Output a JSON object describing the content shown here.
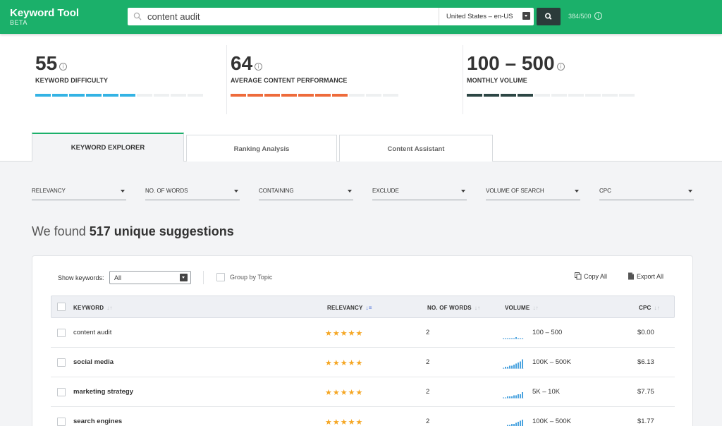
{
  "app": {
    "title": "Keyword Tool",
    "subtitle": "BETA"
  },
  "search": {
    "value": "content audit",
    "locale": "United States – en-US",
    "quota": "384/500"
  },
  "metrics": [
    {
      "value": "55",
      "label": "KEYWORD DIFFICULTY",
      "color": "#34b3e4",
      "filled": 6,
      "total": 10
    },
    {
      "value": "64",
      "label": "AVERAGE CONTENT PERFORMANCE",
      "color": "#ee6b3b",
      "filled": 7,
      "total": 10
    },
    {
      "value": "100 – 500",
      "label": "MONTHLY VOLUME",
      "color": "#2c4644",
      "filled": 4,
      "total": 10
    }
  ],
  "tabs": [
    {
      "label": "KEYWORD EXPLORER",
      "active": true
    },
    {
      "label": "Ranking Analysis",
      "active": false
    },
    {
      "label": "Content Assistant",
      "active": false
    }
  ],
  "filters": [
    "RELEVANCY",
    "NO. OF WORDS",
    "CONTAINING",
    "EXCLUDE",
    "VOLUME OF SEARCH",
    "CPC"
  ],
  "results": {
    "prefix": "We found",
    "count_text": "517 unique suggestions"
  },
  "toolbar": {
    "show_label": "Show keywords:",
    "show_value": "All",
    "group_label": "Group by Topic",
    "copy_label": "Copy All",
    "export_label": "Export All"
  },
  "table": {
    "headers": {
      "keyword": "KEYWORD",
      "relevancy": "RELEVANCY",
      "words": "NO. OF WORDS",
      "volume": "VOLUME",
      "cpc": "CPC"
    },
    "rows": [
      {
        "keyword": "content audit",
        "bold": false,
        "stars": 5,
        "words": "2",
        "volume": "100 – 500",
        "cpc": "$0.00",
        "trend": [
          1,
          1,
          1,
          1,
          1,
          1,
          2,
          1,
          1,
          1
        ]
      },
      {
        "keyword": "social media",
        "bold": true,
        "stars": 5,
        "words": "2",
        "volume": "100K – 500K",
        "cpc": "$6.13",
        "trend": [
          1,
          2,
          2,
          3,
          3,
          4,
          5,
          6,
          7,
          9
        ]
      },
      {
        "keyword": "marketing strategy",
        "bold": true,
        "stars": 5,
        "words": "2",
        "volume": "5K – 10K",
        "cpc": "$7.75",
        "trend": [
          1,
          1,
          2,
          2,
          2,
          3,
          3,
          4,
          4,
          6
        ]
      },
      {
        "keyword": "search engines",
        "bold": true,
        "stars": 5,
        "words": "2",
        "volume": "100K – 500K",
        "cpc": "$1.77",
        "trend": [
          2,
          2,
          3,
          3,
          4,
          4,
          5,
          6,
          7,
          8
        ]
      }
    ]
  },
  "colors": {
    "brand": "#1bb06a",
    "spark": "#4aa3df",
    "star": "#f5a623"
  }
}
